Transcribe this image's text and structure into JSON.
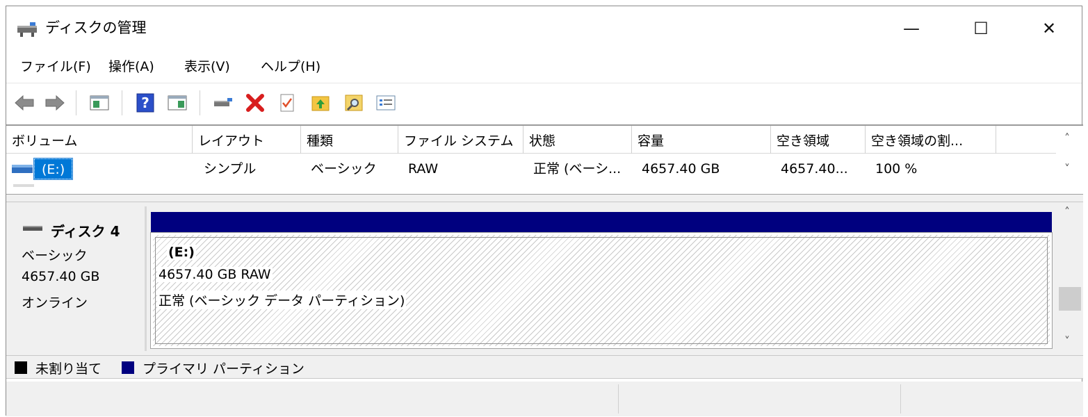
{
  "window": {
    "title": "ディスクの管理",
    "minimize_glyph": "—",
    "maximize_glyph": "☐",
    "close_glyph": "✕"
  },
  "menu": [
    "ファイル(F)",
    "操作(A)",
    "表示(V)",
    "ヘルプ(H)"
  ],
  "toolbar": {
    "icons": [
      "back-arrow-icon",
      "forward-arrow-icon",
      "console-tree-icon",
      "help-icon",
      "action-pane-icon",
      "connect-drive-icon",
      "delete-icon",
      "properties-icon",
      "folder-up-icon",
      "folder-search-icon",
      "list-icon"
    ]
  },
  "volume_list": {
    "columns": [
      "ボリューム",
      "レイアウト",
      "種類",
      "ファイル システム",
      "状態",
      "容量",
      "空き領域",
      "空き領域の割..."
    ],
    "rows": [
      {
        "volume": "(E:)",
        "layout": "シンプル",
        "type": "ベーシック",
        "file_system": "RAW",
        "status": "正常 (ベーシ...",
        "capacity": "4657.40 GB",
        "free_space": "4657.40...",
        "free_percent": "100 %"
      }
    ]
  },
  "disk": {
    "name": "ディスク 4",
    "type": "ベーシック",
    "size": "4657.40 GB",
    "state": "オンライン",
    "partition": {
      "label": "(E:)",
      "size_fs": "4657.40 GB RAW",
      "status": "正常 (ベーシック データ パーティション)"
    }
  },
  "legend": {
    "unallocated": "未割り当て",
    "primary": "プライマリ パーティション",
    "colors": {
      "unallocated": "#000000",
      "primary": "#00007f"
    }
  },
  "scroll": {
    "up": "˄",
    "down": "˅"
  }
}
